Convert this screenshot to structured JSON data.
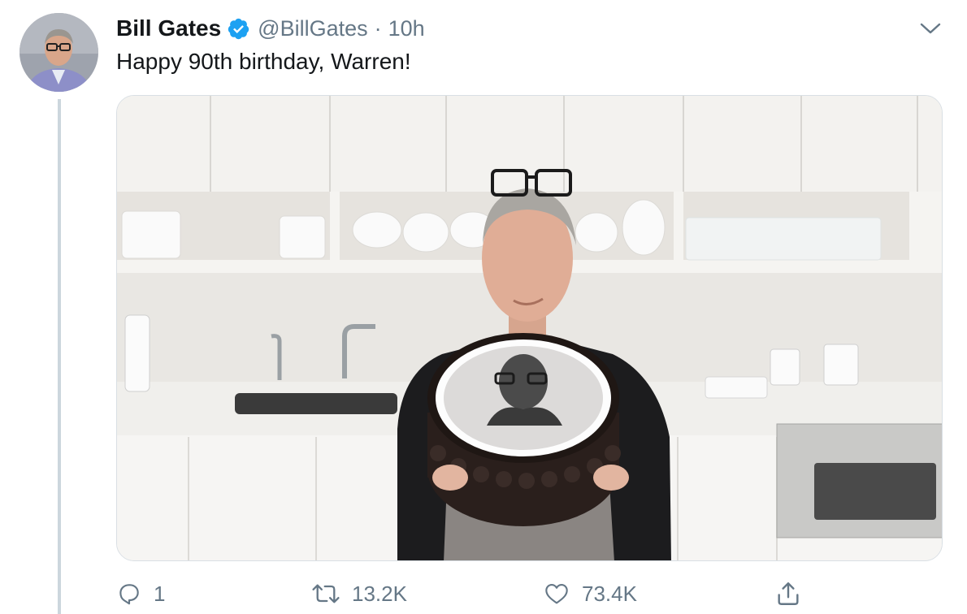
{
  "tweet": {
    "author": {
      "display_name": "Bill Gates",
      "handle": "@BillGates",
      "verified": true
    },
    "separator": "·",
    "time": "10h",
    "text": "Happy 90th birthday, Warren!",
    "media": {
      "description_icon": "photo"
    }
  },
  "actions": {
    "reply_count": "1",
    "retweet_count": "13.2K",
    "like_count": "73.4K"
  },
  "colors": {
    "text_primary": "#14171a",
    "text_secondary": "#657786",
    "verified_blue": "#1da1f2",
    "thread_line": "#ccd6dd"
  }
}
